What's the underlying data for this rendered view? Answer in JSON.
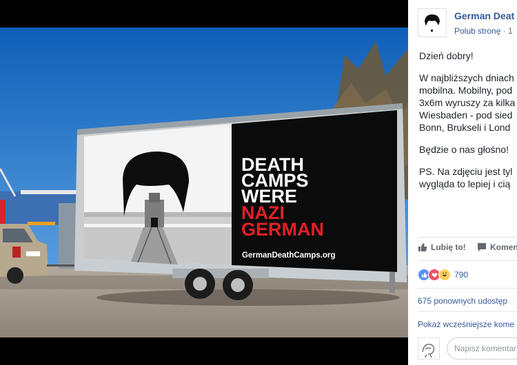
{
  "billboard": {
    "lines": [
      "DEATH",
      "CAMPS",
      "WERE"
    ],
    "highlight_lines": [
      "NAZI",
      "GERMAN"
    ],
    "url": "GermanDeathCamps.org"
  },
  "post": {
    "page_name": "German Deat",
    "like_page": "Polub stronę",
    "separator": "·",
    "time": "1",
    "greeting": "Dzień dobry!",
    "body_lines": [
      "W najbliższych dniach",
      "mobilna. Mobilny, pod",
      "3x6m wyruszy za kilka",
      "Wiesbaden - pod sied",
      "Bonn, Brukseli i Lond"
    ],
    "loud": "Będzie o nas głośno!",
    "ps_lines": [
      "PS. Na zdjęciu jest tyl",
      "wygląda to lepiej i cią"
    ]
  },
  "actions": {
    "like": "Lubię to!",
    "comment": "Komen"
  },
  "reactions": {
    "icons": [
      "like-icon",
      "love-icon",
      "haha-icon"
    ],
    "colors": {
      "like": "#5890ff",
      "love": "#f25268",
      "haha": "#fcd25a",
      "accent": "#365899"
    },
    "count": "790"
  },
  "shares": "675 ponownych udostęp",
  "more_comments": "Pokaż wcześniejsze kome",
  "comment_input": {
    "placeholder": "Napisz komentar"
  }
}
